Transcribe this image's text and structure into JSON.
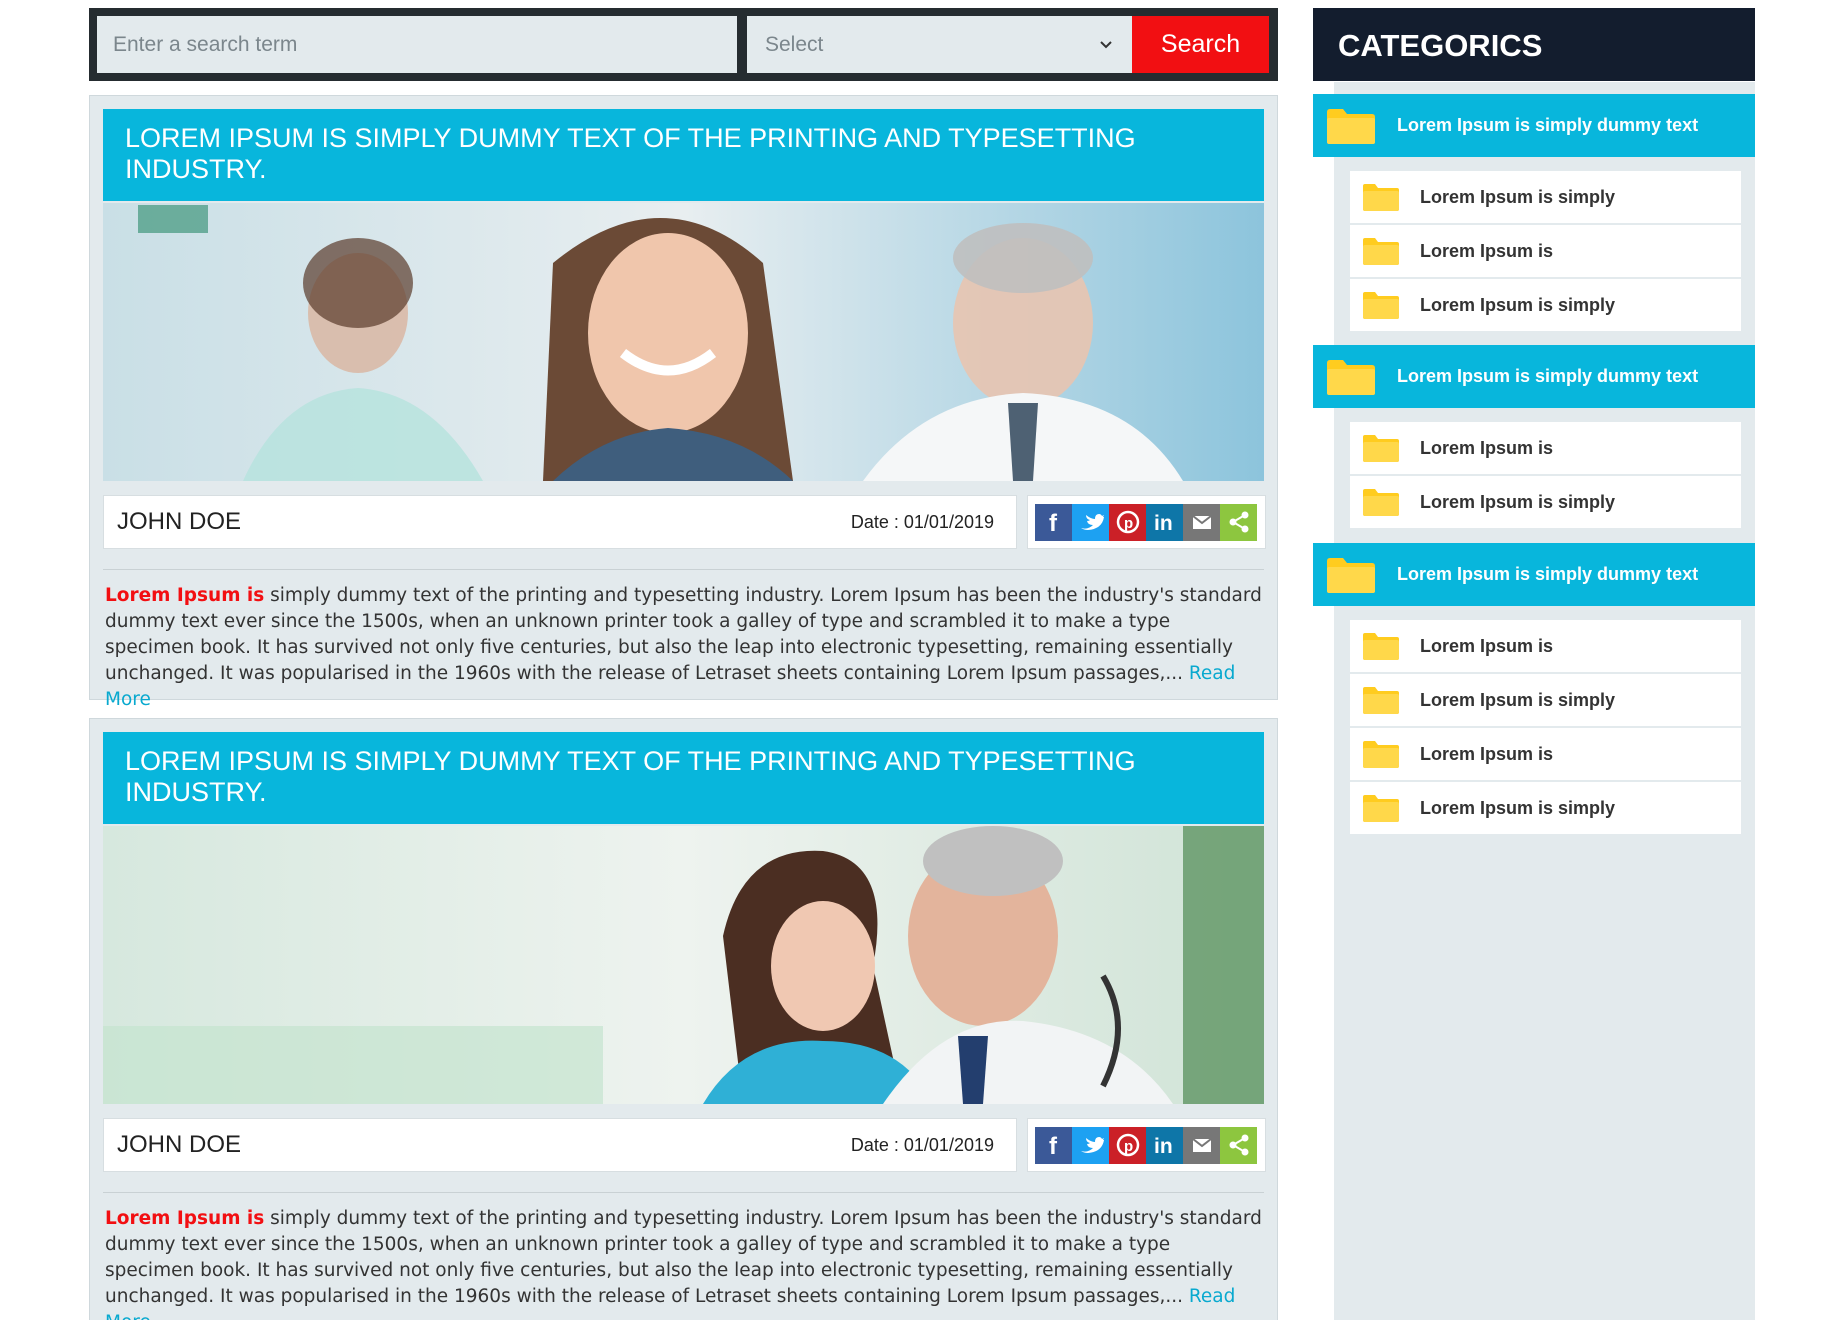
{
  "search": {
    "placeholder": "Enter a search term",
    "select_value": "Select",
    "button_label": "Search"
  },
  "posts": [
    {
      "title": "LOREM IPSUM IS SIMPLY DUMMY TEXT OF THE PRINTING AND TYPESETTING INDUSTRY.",
      "author": "JOHN DOE",
      "date": "Date : 01/01/2019",
      "lead": "Lorem Ipsum is",
      "body": " simply dummy text of the printing and typesetting industry. Lorem Ipsum has been the industry's standard dummy text ever since the 1500s, when an unknown printer took a galley of type and scrambled it to make a type specimen book. It has survived not only five centuries, but also the leap into electronic typesetting, remaining essentially unchanged. It was popularised in the 1960s with the release of Letraset sheets containing Lorem Ipsum passages,... ",
      "read_more": "Read More"
    },
    {
      "title": "LOREM IPSUM IS SIMPLY DUMMY TEXT OF THE PRINTING AND TYPESETTING INDUSTRY.",
      "author": "JOHN DOE",
      "date": "Date : 01/01/2019",
      "lead": "Lorem Ipsum is",
      "body": " simply dummy text of the printing and typesetting industry. Lorem Ipsum has been the industry's standard dummy text ever since the 1500s, when an unknown printer took a galley of type and scrambled it to make a type specimen book. It has survived not only five centuries, but also the leap into electronic typesetting, remaining essentially unchanged. It was popularised in the 1960s with the release of Letraset sheets containing Lorem Ipsum passages,... ",
      "read_more": "Read More"
    }
  ],
  "social_icons": [
    "facebook-icon",
    "twitter-icon",
    "pinterest-icon",
    "linkedin-icon",
    "email-icon",
    "share-icon"
  ],
  "sidebar": {
    "title": "CATEGORICS",
    "groups": [
      {
        "label": "Lorem Ipsum is simply dummy text",
        "items": [
          "Lorem Ipsum is simply",
          "Lorem Ipsum is",
          "Lorem Ipsum is simply"
        ]
      },
      {
        "label": "Lorem Ipsum is simply dummy text",
        "items": [
          "Lorem Ipsum is",
          "Lorem Ipsum is simply"
        ]
      },
      {
        "label": "Lorem Ipsum is simply dummy text",
        "items": [
          "Lorem Ipsum is",
          "Lorem Ipsum is simply",
          "Lorem Ipsum is",
          "Lorem Ipsum is simply"
        ]
      }
    ]
  },
  "colors": {
    "accent": "#08b6dc",
    "search_button": "#f20f12",
    "dark_header": "#131d2e",
    "folder": "#ffcc1f"
  }
}
